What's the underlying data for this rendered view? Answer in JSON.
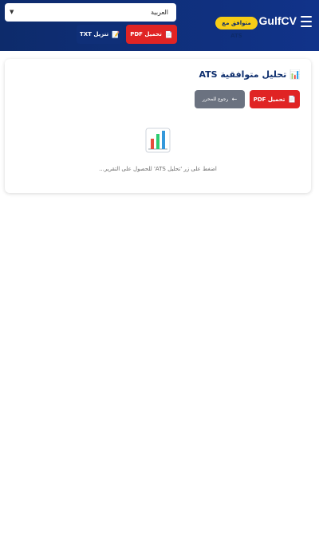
{
  "header": {
    "logo": "GulfCV",
    "badge": "متوافق مع ATS",
    "menu_icon": "hamburger-menu-icon"
  },
  "language_select": {
    "value": "العربية",
    "chevron_icon": "chevron-down-icon"
  },
  "toolbar": {
    "pdf_label": "تحميل PDF",
    "txt_label": "تنزيل TXT",
    "pdf_icon": "document-icon",
    "txt_icon": "notepad-icon"
  },
  "card": {
    "title": "تحليل متوافقية ATS",
    "title_icon": "bar-chart-icon",
    "pdf_label": "تحميل PDF",
    "back_label": "رجوع للمحرر",
    "back_icon": "arrow-icon",
    "empty_icon": "bar-chart-icon",
    "hint": "اضغط على زر 'تحليل ATS' للحصول على التقرير..."
  },
  "colors": {
    "header_bg": "#0d2b6b",
    "badge_bg": "#f7cd16",
    "pdf_red": "#e02424",
    "txt_navy": "#0f2f78",
    "back_gray": "#6b7280",
    "title_navy": "#10306f"
  }
}
